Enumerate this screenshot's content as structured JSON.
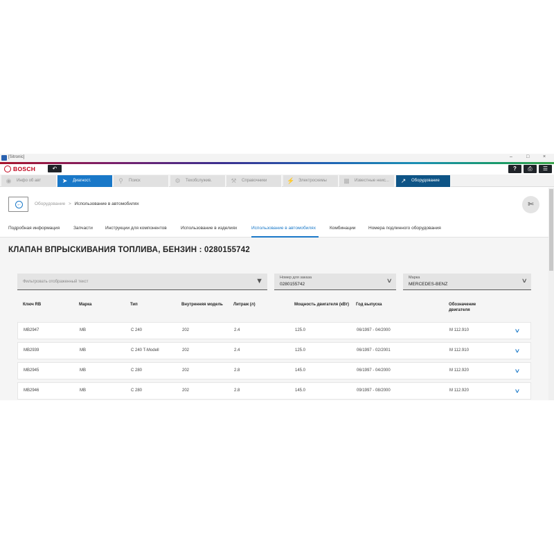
{
  "window": {
    "title": "[Sitronic]"
  },
  "brand": {
    "name": "BOSCH"
  },
  "toolbar": {
    "back_icon": "undo-arrow-icon",
    "help_label": "?",
    "right_icons": [
      "help-icon",
      "print-icon",
      "menu-icon"
    ]
  },
  "tabs": [
    {
      "label": "Инфо об авт",
      "icon": "car-info-icon"
    },
    {
      "label": "Диагност.",
      "icon": "diagnostic-icon"
    },
    {
      "label": "Поиск",
      "icon": "search-icon"
    },
    {
      "label": "Техобслужив.",
      "icon": "gears-icon"
    },
    {
      "label": "Справочники",
      "icon": "wrench-icon"
    },
    {
      "label": "Электросхемы",
      "icon": "lightning-icon"
    },
    {
      "label": "Известные неис...",
      "icon": "known-issues-icon"
    },
    {
      "label": "Оборудование",
      "icon": "external-link-icon"
    }
  ],
  "breadcrumb": {
    "parent": "Оборудование",
    "separator": ">",
    "current": "Использование в автомобилях"
  },
  "subtabs": [
    "Подробная информация",
    "Запчасти",
    "Инструкции для компонентов",
    "Использование в изделиях",
    "Использование в автомобилях",
    "Комбинации",
    "Номера подлинного оборудования"
  ],
  "page_title": "КЛАПАН ВПРЫСКИВАНИЯ ТОПЛИВА, БЕНЗИН : 0280155742",
  "filter": {
    "placeholder": "Фильтровать отображенный текст"
  },
  "order_select": {
    "label": "Номер для заказа",
    "value": "0280155742"
  },
  "brand_select": {
    "label": "Марка",
    "value": "MERCEDES-BENZ"
  },
  "table": {
    "headers": [
      "Ключ RB",
      "Марка",
      "Тип",
      "Внутренняя модель",
      "Литраж (л)",
      "Мощность двигателя (кВт)",
      "Год выпуска",
      "Обозначение двигателя"
    ],
    "rows": [
      [
        "MB2947",
        "MB",
        "C 240",
        "202",
        "2.4",
        "125.0",
        "06/1997 - 04/2000",
        "M 112.910"
      ],
      [
        "MB2939",
        "MB",
        "C 240 T-Modell",
        "202",
        "2.4",
        "125.0",
        "06/1997 - 02/2001",
        "M 112.910"
      ],
      [
        "MB2945",
        "MB",
        "C 280",
        "202",
        "2.8",
        "145.0",
        "06/1997 - 04/2000",
        "M 112.920"
      ],
      [
        "MB2946",
        "MB",
        "C 280",
        "202",
        "2.8",
        "145.0",
        "09/1997 - 08/2000",
        "M 112.920"
      ]
    ]
  }
}
